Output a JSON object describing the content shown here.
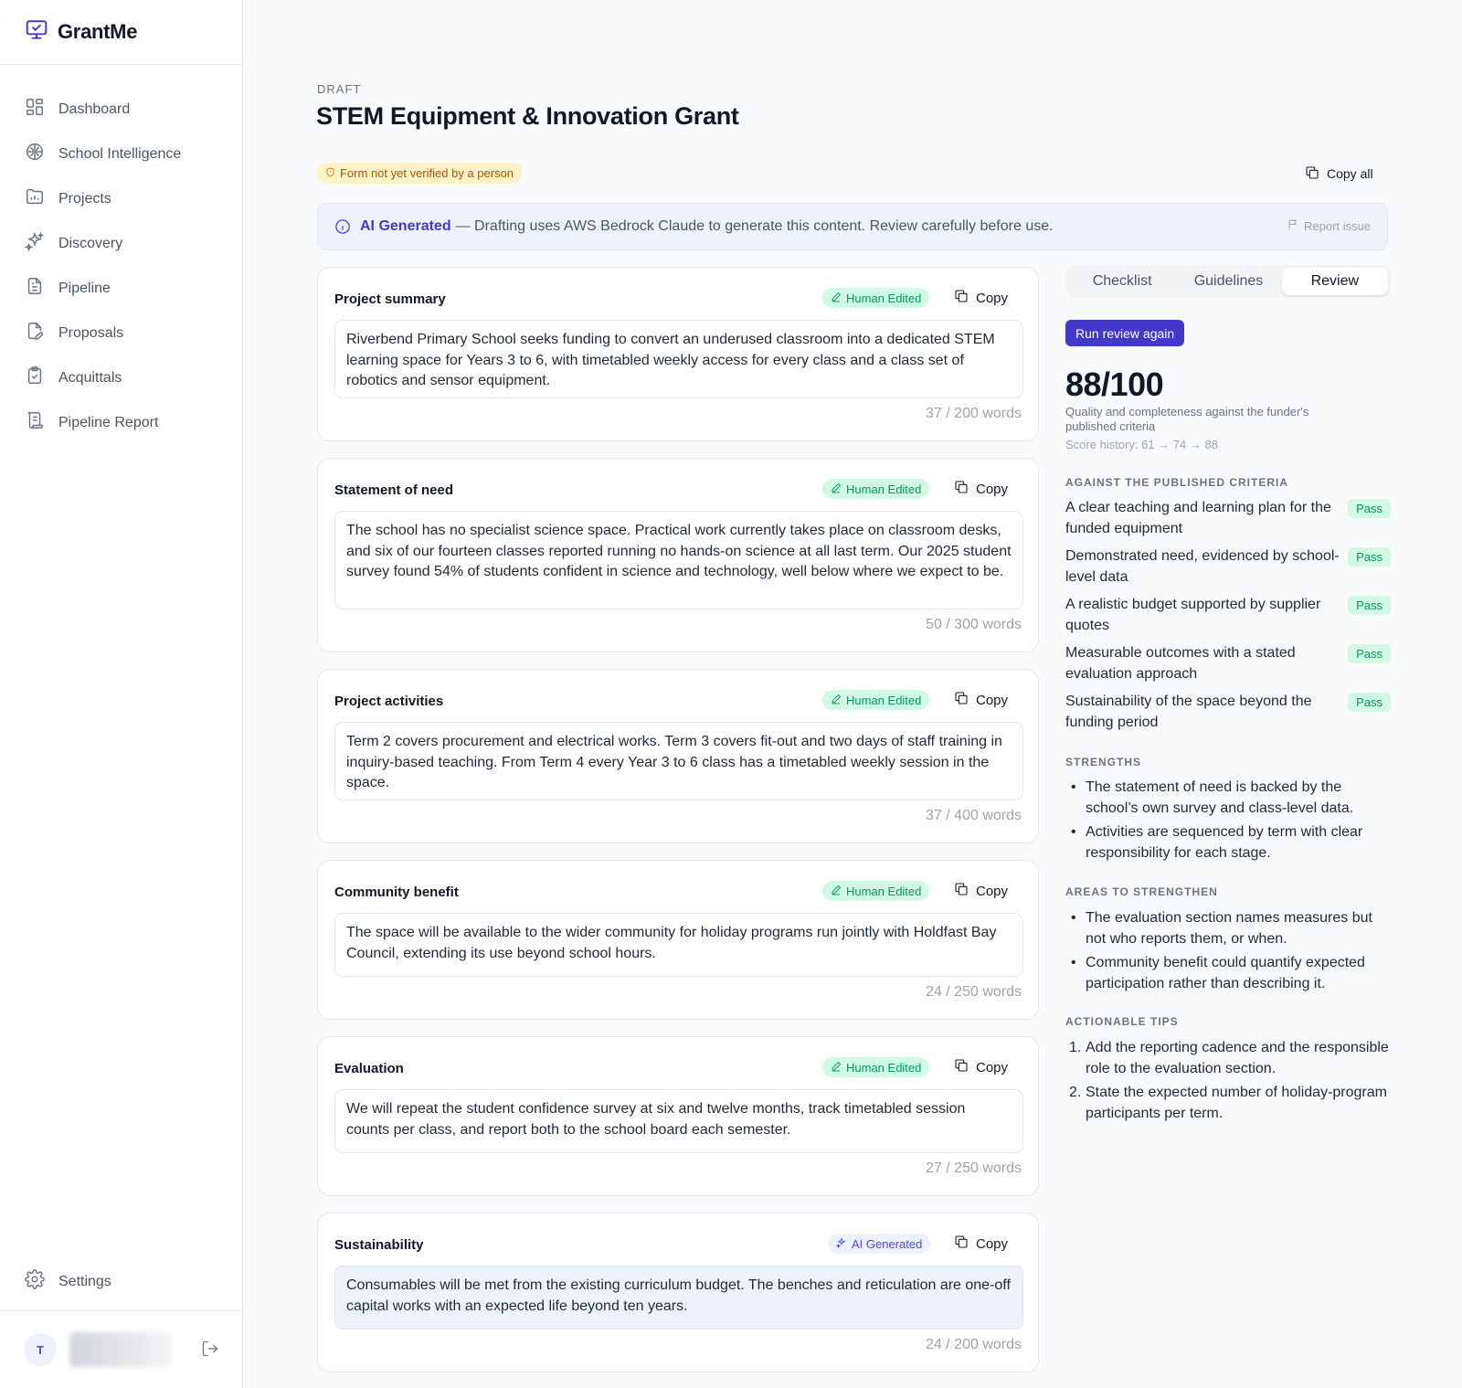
{
  "app": {
    "name": "GrantMe"
  },
  "sidebar": {
    "items": [
      {
        "label": "Dashboard",
        "icon": "grid-icon"
      },
      {
        "label": "School Intelligence",
        "icon": "brain-icon"
      },
      {
        "label": "Projects",
        "icon": "folder-chart-icon"
      },
      {
        "label": "Discovery",
        "icon": "sparkles-icon"
      },
      {
        "label": "Pipeline",
        "icon": "document-icon"
      },
      {
        "label": "Proposals",
        "icon": "file-pen-icon"
      },
      {
        "label": "Acquittals",
        "icon": "clipboard-check-icon"
      },
      {
        "label": "Pipeline Report",
        "icon": "scroll-icon"
      }
    ],
    "settings_label": "Settings",
    "user": {
      "initial": "T"
    }
  },
  "header": {
    "status": "DRAFT",
    "title": "STEM Equipment & Innovation Grant",
    "verify_badge": "Form not yet verified by a person",
    "copy_all_label": "Copy all"
  },
  "ai_banner": {
    "strong": "AI Generated",
    "text": "— Drafting uses AWS Bedrock Claude to generate this content. Review carefully before use.",
    "report_label": "Report issue"
  },
  "sections": [
    {
      "title": "Project summary",
      "badge": "Human Edited",
      "copy_label": "Copy",
      "text": "Riverbend Primary School seeks funding to convert an underused classroom into a dedicated STEM learning space for Years 3 to 6, with timetabled weekly access for every class and a class set of robotics and sensor equipment.",
      "word_count": "37 / 200 words"
    },
    {
      "title": "Statement of need",
      "badge": "Human Edited",
      "copy_label": "Copy",
      "text": "The school has no specialist science space. Practical work currently takes place on classroom desks, and six of our fourteen classes reported running no hands-on science at all last term. Our 2025 student survey found 54% of students confident in science and technology, well below where we expect to be.",
      "word_count": "50 / 300 words"
    },
    {
      "title": "Project activities",
      "badge": "Human Edited",
      "copy_label": "Copy",
      "text": "Term 2 covers procurement and electrical works. Term 3 covers fit-out and two days of staff training in inquiry-based teaching. From Term 4 every Year 3 to 6 class has a timetabled weekly session in the space.",
      "word_count": "37 / 400 words"
    },
    {
      "title": "Community benefit",
      "badge": "Human Edited",
      "copy_label": "Copy",
      "text": "The space will be available to the wider community for holiday programs run jointly with Holdfast Bay Council, extending its use beyond school hours.",
      "word_count": "24 / 250 words"
    },
    {
      "title": "Evaluation",
      "badge": "Human Edited",
      "copy_label": "Copy",
      "text": "We will repeat the student confidence survey at six and twelve months, track timetabled session counts per class, and report both to the school board each semester.",
      "word_count": "27 / 250 words"
    },
    {
      "title": "Sustainability",
      "badge": "AI Generated",
      "copy_label": "Copy",
      "text": "Consumables will be met from the existing curriculum budget. The benches and reticulation are one-off capital works with an expected life beyond ten years.",
      "word_count": "24 / 200 words"
    }
  ],
  "review": {
    "tabs": [
      "Checklist",
      "Guidelines",
      "Review"
    ],
    "active_tab": "Review",
    "run_label": "Run review again",
    "score": "88/100",
    "score_desc": "Quality and completeness against the funder's published criteria",
    "score_history": "Score history: 61 → 74 → 88",
    "criteria_heading": "AGAINST THE PUBLISHED CRITERIA",
    "criteria": [
      {
        "text": "A clear teaching and learning plan for the funded equipment",
        "status": "Pass"
      },
      {
        "text": "Demonstrated need, evidenced by school-level data",
        "status": "Pass"
      },
      {
        "text": "A realistic budget supported by supplier quotes",
        "status": "Pass"
      },
      {
        "text": "Measurable outcomes with a stated evaluation approach",
        "status": "Pass"
      },
      {
        "text": "Sustainability of the space beyond the funding period",
        "status": "Pass"
      }
    ],
    "strengths_heading": "STRENGTHS",
    "strengths": [
      "The statement of need is backed by the school’s own survey and class-level data.",
      "Activities are sequenced by term with clear responsibility for each stage."
    ],
    "areas_heading": "AREAS TO STRENGTHEN",
    "areas": [
      "The evaluation section names measures but not who reports them, or when.",
      "Community benefit could quantify expected participation rather than describing it."
    ],
    "tips_heading": "ACTIONABLE TIPS",
    "tips": [
      "Add the reporting cadence and the responsible role to the evaluation section.",
      "State the expected number of holiday-program participants per term."
    ]
  },
  "colors": {
    "accent": "#4338ca",
    "pass_bg": "#d1fae5",
    "pass_text": "#059669",
    "warning_bg": "#fef3c7",
    "warning_text": "#b45309"
  }
}
